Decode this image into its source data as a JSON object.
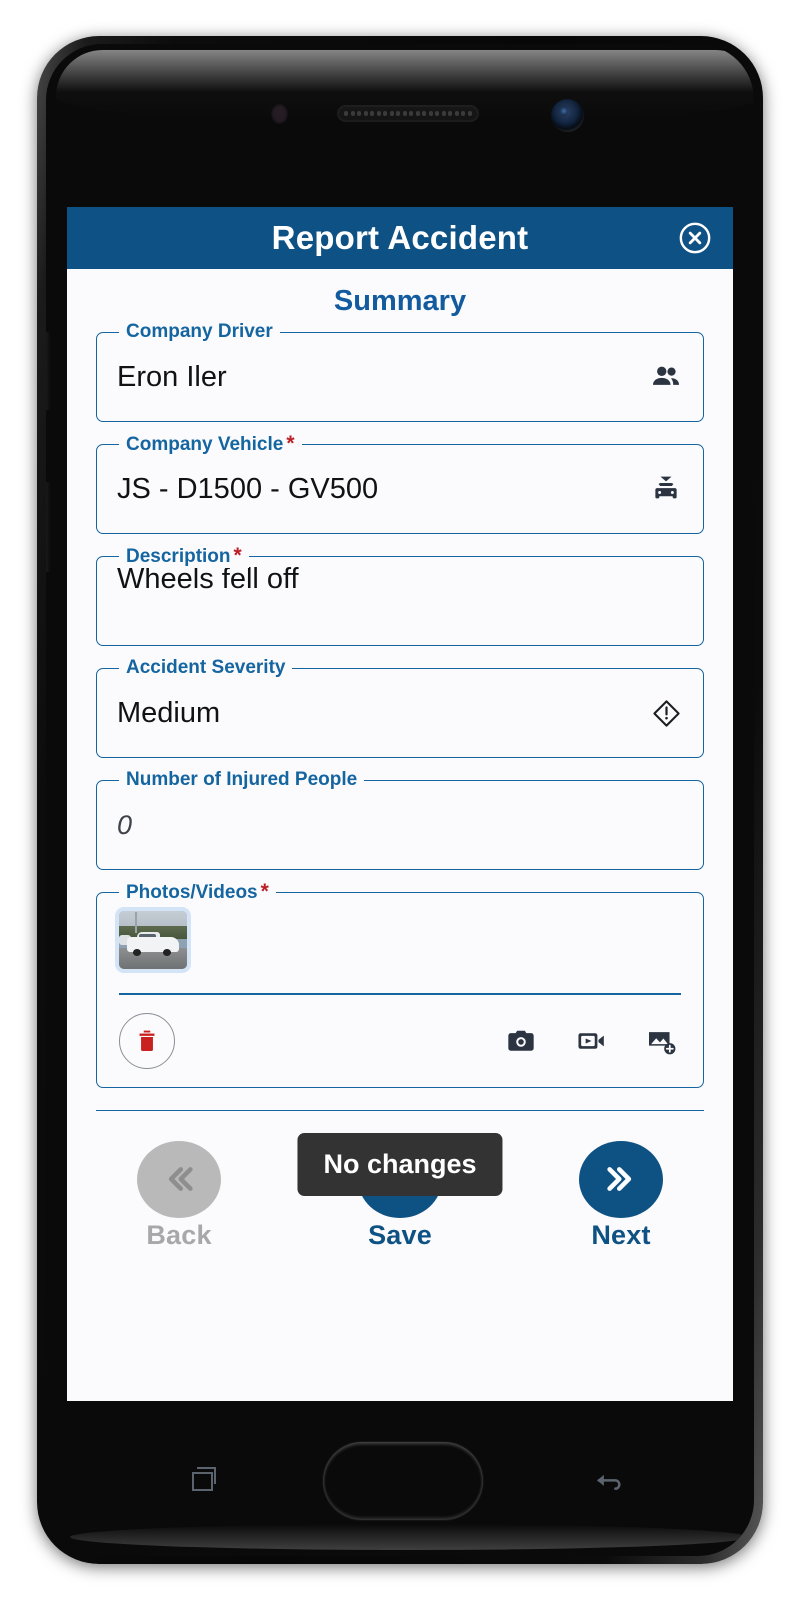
{
  "device": {
    "nav": {
      "recent_apps": "recent-apps",
      "home": "home-button",
      "back": "back-button"
    }
  },
  "app": {
    "header": {
      "title": "Report Accident",
      "close_icon": "close-circle-icon"
    },
    "page_title": "Summary",
    "fields": [
      {
        "key": "company_driver",
        "label": "Company Driver",
        "required": false,
        "value": "Eron Iler",
        "is_placeholder": false,
        "icon": "people-icon"
      },
      {
        "key": "company_vehicle",
        "label": "Company Vehicle",
        "required": true,
        "value": "JS - D1500 - GV500",
        "is_placeholder": false,
        "icon": "taxi-car-icon"
      },
      {
        "key": "description",
        "label": "Description",
        "required": true,
        "value": "Wheels fell off",
        "is_placeholder": false,
        "icon": ""
      },
      {
        "key": "accident_severity",
        "label": "Accident Severity",
        "required": false,
        "value": "Medium",
        "is_placeholder": false,
        "icon": "warning-diamond-icon"
      },
      {
        "key": "number_of_injured_people",
        "label": "Number of Injured People",
        "required": false,
        "value": "0",
        "is_placeholder": true,
        "icon": ""
      }
    ],
    "photos": {
      "label": "Photos/Videos",
      "required": true,
      "thumbnail_alt": "white pickup truck in parking lot",
      "delete_icon": "trash-icon",
      "actions": [
        {
          "key": "take_photo",
          "icon": "camera-icon"
        },
        {
          "key": "record_video",
          "icon": "video-camera-icon"
        },
        {
          "key": "add_from_gallery",
          "icon": "add-image-icon"
        }
      ]
    },
    "bottom_nav": {
      "back": {
        "label": "Back",
        "icon": "double-chevron-left-icon",
        "disabled": true
      },
      "save": {
        "label": "Save",
        "icon": "save-icon",
        "disabled": false
      },
      "next": {
        "label": "Next",
        "icon": "double-chevron-right-icon",
        "disabled": false
      }
    },
    "toast": "No changes",
    "colors": {
      "header_blue": "#0e5285",
      "accent_blue": "#1565a0",
      "title_blue": "#115b9e",
      "required_red": "#bb2026",
      "trash_red": "#c9211f",
      "disabled_gray": "#b9b9b9",
      "toast_bg": "#333333"
    }
  }
}
